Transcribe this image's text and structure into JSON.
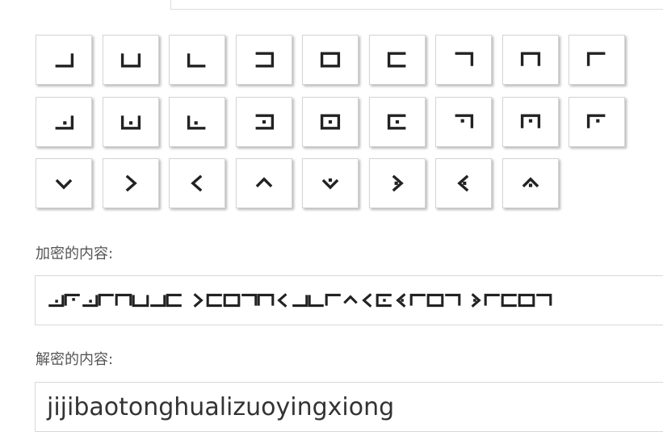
{
  "top_tabs": [
    "",
    ""
  ],
  "keys": [
    {
      "symbol": "pigpen-1"
    },
    {
      "symbol": "pigpen-2"
    },
    {
      "symbol": "pigpen-3"
    },
    {
      "symbol": "pigpen-4"
    },
    {
      "symbol": "pigpen-5"
    },
    {
      "symbol": "pigpen-6"
    },
    {
      "symbol": "pigpen-7"
    },
    {
      "symbol": "pigpen-8"
    },
    {
      "symbol": "pigpen-9"
    },
    {
      "symbol": "pigpen-dot-1"
    },
    {
      "symbol": "pigpen-dot-2"
    },
    {
      "symbol": "pigpen-dot-3"
    },
    {
      "symbol": "pigpen-dot-4"
    },
    {
      "symbol": "pigpen-dot-5"
    },
    {
      "symbol": "pigpen-dot-6"
    },
    {
      "symbol": "pigpen-dot-7"
    },
    {
      "symbol": "pigpen-dot-8"
    },
    {
      "symbol": "pigpen-dot-9"
    },
    {
      "symbol": "pigpen-v-down"
    },
    {
      "symbol": "pigpen-v-right"
    },
    {
      "symbol": "pigpen-v-left"
    },
    {
      "symbol": "pigpen-v-up"
    },
    {
      "symbol": "pigpen-v-down-dot"
    },
    {
      "symbol": "pigpen-v-right-dot"
    },
    {
      "symbol": "pigpen-v-left-dot"
    },
    {
      "symbol": "pigpen-v-up-dot"
    }
  ],
  "encrypted": {
    "label": "加密的内容:",
    "symbols": [
      "d1",
      "d9",
      "d1",
      "9",
      "8",
      "2",
      "1",
      "6",
      "sp",
      "v2",
      "6",
      "5",
      "7",
      "8",
      "v3",
      "1",
      "3",
      "9",
      "v4",
      "v3",
      "d6",
      "v7",
      "9",
      "5",
      "7",
      "sp",
      "v6",
      "9",
      "6",
      "5",
      "7"
    ]
  },
  "decrypted": {
    "label": "解密的内容:",
    "value": "jijibaotonghualizuoyingxiong"
  }
}
